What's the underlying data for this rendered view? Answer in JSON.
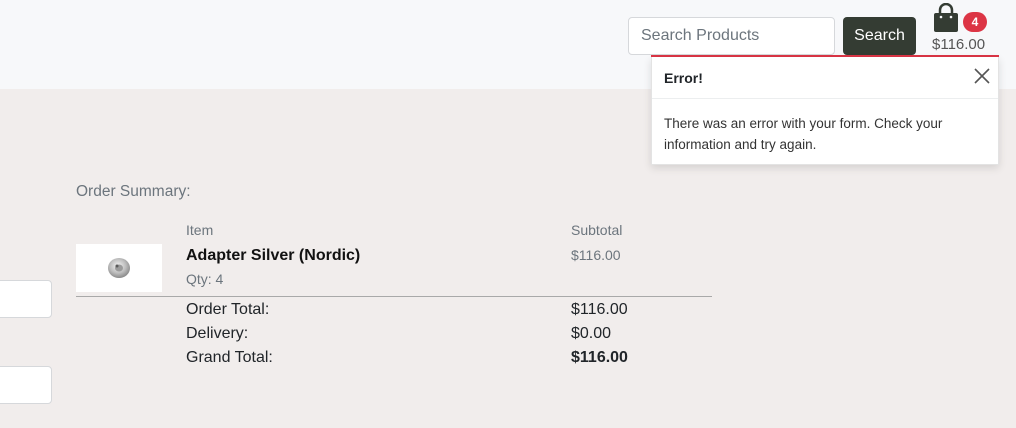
{
  "header": {
    "search_placeholder": "Search Products",
    "search_button": "Search",
    "cart": {
      "icon": "shopping-bag-icon",
      "count": "4",
      "total": "$116.00"
    }
  },
  "toast": {
    "title": "Error!",
    "message": "There was an error with your form. Check your information and try again.",
    "close_icon": "close-icon"
  },
  "order_summary": {
    "title": "Order Summary:",
    "columns": {
      "item": "Item",
      "subtotal": "Subtotal"
    },
    "product": {
      "name": "Adapter Silver (Nordic)",
      "qty": "Qty: 4",
      "subtotal": "$116.00"
    },
    "totals": [
      {
        "label": "Order Total:",
        "value": "$116.00"
      },
      {
        "label": "Delivery:",
        "value": "$0.00"
      },
      {
        "label": "Grand Total:",
        "value": "$116.00"
      }
    ]
  },
  "colors": {
    "accent": "#343c33",
    "badge": "#dc3545",
    "background": "#f1edec",
    "header_bg": "#f7f8fa"
  }
}
